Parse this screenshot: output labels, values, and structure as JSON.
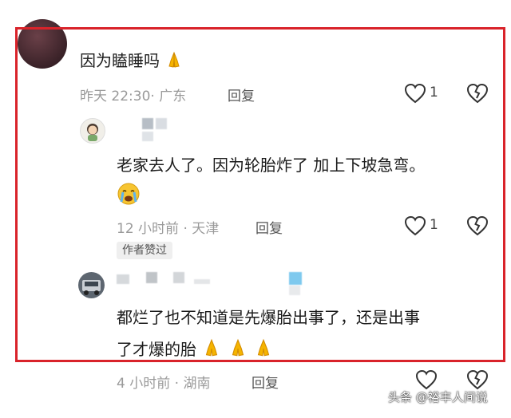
{
  "comment": {
    "text": "因为瞌睡吗",
    "time": "昨天 22:30",
    "location": "· 广东",
    "reply_label": "回复",
    "like_count": "1"
  },
  "reply1": {
    "text": "老家去人了。因为轮胎炸了 加上下坡急弯。",
    "time": "12 小时前",
    "location": "· 天津",
    "reply_label": "回复",
    "like_count": "1",
    "badge": "作者赞过"
  },
  "reply2": {
    "text_line1": "都烂了也不知道是先爆胎出事了，还是出事",
    "text_line2": "了才爆的胎",
    "time": "4 小时前",
    "location": "· 湖南",
    "reply_label": "回复"
  },
  "watermark": "头条 @裕丰人间说",
  "colors": {
    "frame": "#d9232a",
    "meta": "#9a9a9a"
  },
  "icons": [
    "heart-icon",
    "dislike-heart-icon",
    "pray-emoji-icon",
    "crying-emoji-icon"
  ]
}
